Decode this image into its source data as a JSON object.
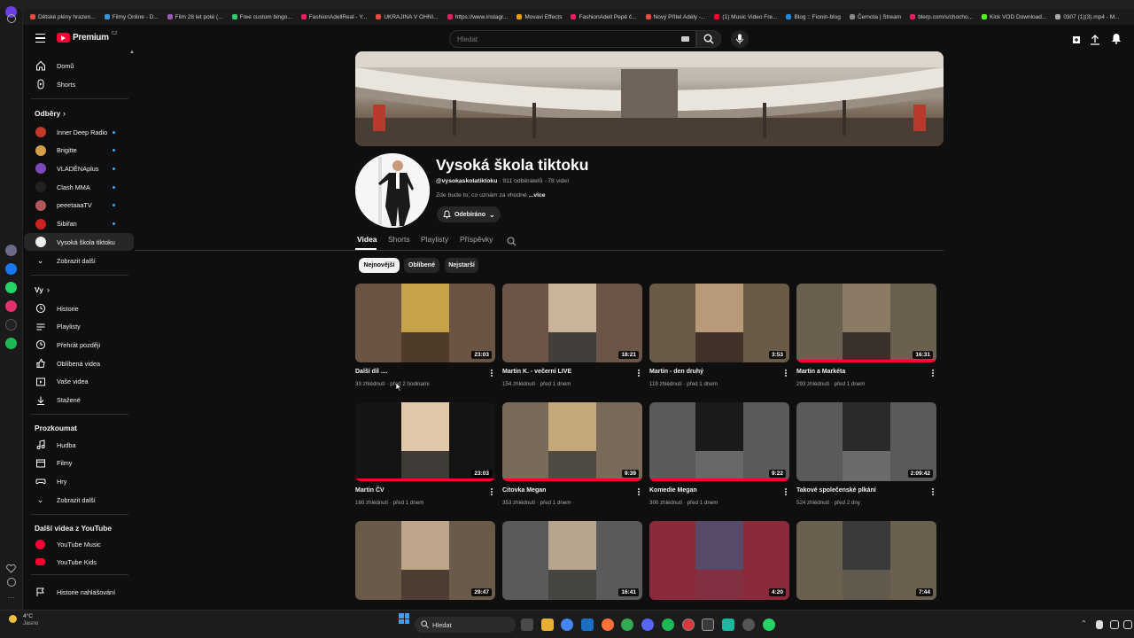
{
  "bookmarks": [
    "Dětské plény hrazen...",
    "Filmy Online - D...",
    "Film 28 let poté (...",
    "Free custom bingo...",
    "FashionAdellReal - Y...",
    "UKRAJINA V OHNI...",
    "https://www.instagr...",
    "Movavi Effects",
    "FashionAdell Pepé č...",
    "Nový Přítel Adély -...",
    "(1) Music Video Fre...",
    "Blog :: Fionin-blog",
    "Černota | Stream",
    "blerp.com/s/chocho...",
    "Kick VOD Download...",
    "0307 (1)(3).mp4 - M..."
  ],
  "header": {
    "logo_text": "Premium",
    "logo_region": "CZ",
    "search_placeholder": "Hledat"
  },
  "sidebar": {
    "home": "Domů",
    "shorts": "Shorts",
    "subs_heading": "Odběry",
    "subscriptions": [
      {
        "label": "Inner Deep Radio",
        "color": "#c0392b"
      },
      {
        "label": "Brigitte",
        "color": "#d4a04a"
      },
      {
        "label": "VLADĚNAplus",
        "color": "#7b4ab8"
      },
      {
        "label": "Clash MMA",
        "color": "#222222"
      },
      {
        "label": "peeetaaaTV",
        "color": "#b05a5a"
      },
      {
        "label": "Sibiřan",
        "color": "#cc2222"
      },
      {
        "label": "Vysoká škola tiktoku",
        "color": "#eeeeee"
      }
    ],
    "show_more": "Zobrazit další",
    "you_heading": "Vy",
    "you_items": [
      "Historie",
      "Playlisty",
      "Přehrát později",
      "Oblíbená videa",
      "Vaše videa",
      "Stažené"
    ],
    "explore_heading": "Prozkoumat",
    "explore_items": [
      "Hudba",
      "Filmy",
      "Hry"
    ],
    "explore_more": "Zobrazit další",
    "more_heading": "Další videa z YouTube",
    "more_items": [
      "YouTube Music",
      "YouTube Kids"
    ],
    "history_settings": "Historie nahlašování"
  },
  "channel": {
    "name": "Vysoká škola tiktoku",
    "meta": "@vysokaskolatiktoku · 911 odběratelů · 78 videí",
    "handle": "@vysokaskolatiktoku",
    "stats": "· 911 odběratelů · 78 videí",
    "description": "Zde bude to, co uznám za vhodné",
    "more": "...více",
    "subscribed_label": "Odebíráno"
  },
  "tabs": [
    "Videa",
    "Shorts",
    "Playlisty",
    "Příspěvky"
  ],
  "chips": [
    "Nejnovější",
    "Oblíbené",
    "Nejstarší"
  ],
  "videos": [
    {
      "title": "Další díl ....",
      "meta": "33 zhlédnutí · před 2 hodinami",
      "duration": "23:03",
      "progress": 0.0
    },
    {
      "title": "Martin K. - večerní LIVE",
      "meta": "154 zhlédnutí · před 1 dnem",
      "duration": "18:21",
      "progress": 0.0
    },
    {
      "title": "Martin - den druhý",
      "meta": "119 zhlédnutí · před 1 dnem",
      "duration": "3:53",
      "progress": 0.0
    },
    {
      "title": "Martin a Markéta",
      "meta": "293 zhlédnutí · před 1 dnem",
      "duration": "16:31",
      "progress": 1.0
    },
    {
      "title": "Martin ČV",
      "meta": "160 zhlédnutí · před 1 dnem",
      "duration": "23:03",
      "progress": 1.0
    },
    {
      "title": "Citovka Megan",
      "meta": "353 zhlédnutí · před 1 dnem",
      "duration": "9:39",
      "progress": 1.0
    },
    {
      "title": "Komedie Megan",
      "meta": "300 zhlédnutí · před 1 dnem",
      "duration": "9:22",
      "progress": 1.0
    },
    {
      "title": "Takové společenské plkání",
      "meta": "524 zhlédnutí · před 2 dny",
      "duration": "2:09:42",
      "progress": 0.0
    },
    {
      "title": "",
      "meta": "",
      "duration": "29:47",
      "progress": 0.0
    },
    {
      "title": "",
      "meta": "",
      "duration": "16:41",
      "progress": 0.0
    },
    {
      "title": "",
      "meta": "",
      "duration": "4:20",
      "progress": 0.0
    },
    {
      "title": "",
      "meta": "",
      "duration": "7:44",
      "progress": 0.0
    }
  ],
  "taskbar": {
    "weather_temp": "4°C",
    "weather_desc": "Jasno",
    "search_label": "Hledat"
  },
  "colors": {
    "accent": "#ff0033",
    "background": "#0f0f0f",
    "chip": "#272727"
  }
}
